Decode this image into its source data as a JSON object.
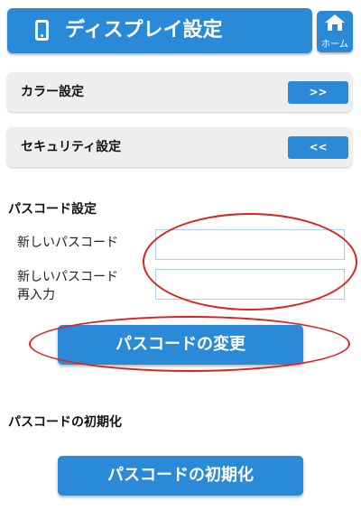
{
  "header": {
    "title": "ディスプレイ設定",
    "icon": "smartphone-icon",
    "home_label": "ホーム",
    "home_icon": "home-icon"
  },
  "settings": {
    "color": {
      "label": "カラー設定",
      "toggle": ">>"
    },
    "security": {
      "label": "セキュリティ設定",
      "toggle": "<<"
    }
  },
  "passcode": {
    "heading": "パスコード設定",
    "new_label": "新しいパスコード",
    "confirm_label_line1": "新しいパスコード",
    "confirm_label_line2": "再入力",
    "new_value": "",
    "confirm_value": "",
    "change_button": "パスコードの変更"
  },
  "reset": {
    "heading": "パスコードの初期化",
    "button": "パスコードの初期化"
  },
  "colors": {
    "accent": "#2a8ad8",
    "row_background": "#eeeeee",
    "annotation": "#e02020"
  }
}
